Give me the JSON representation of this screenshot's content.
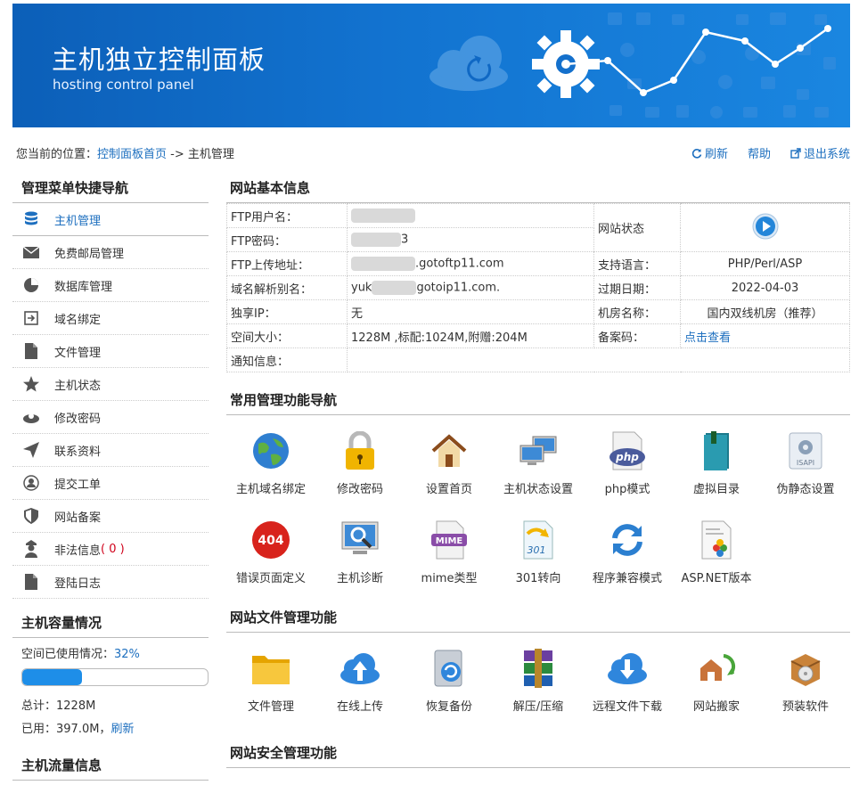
{
  "banner": {
    "title": "主机独立控制面板",
    "subtitle": "hosting control panel"
  },
  "breadcrumb": {
    "prefix": "您当前的位置：",
    "home": "控制面板首页",
    "sep": " -> ",
    "current": "主机管理"
  },
  "toplinks": {
    "refresh": "刷新",
    "help": "帮助",
    "logout": "退出系统"
  },
  "sidebar": {
    "title": "管理菜单快捷导航",
    "items": [
      {
        "label": "主机管理",
        "icon": "database-icon"
      },
      {
        "label": "免费邮局管理",
        "icon": "mail-icon"
      },
      {
        "label": "数据库管理",
        "icon": "pie-icon"
      },
      {
        "label": "域名绑定",
        "icon": "login-arrow-icon"
      },
      {
        "label": "文件管理",
        "icon": "file-icon"
      },
      {
        "label": "主机状态",
        "icon": "star-icon"
      },
      {
        "label": "修改密码",
        "icon": "key-icon"
      },
      {
        "label": "联系资料",
        "icon": "send-icon"
      },
      {
        "label": "提交工单",
        "icon": "user-icon"
      },
      {
        "label": "网站备案",
        "icon": "shield-icon"
      },
      {
        "label": "非法信息",
        "icon": "police-icon",
        "count": "( 0 )"
      },
      {
        "label": "登陆日志",
        "icon": "file-icon"
      }
    ]
  },
  "capacity": {
    "title": "主机容量情况",
    "used_label": "空间已使用情况：",
    "used_pct": "32%",
    "used_fraction": 0.32,
    "total": "总计：1228M",
    "used": "已用：397.0M，",
    "refresh": "刷新"
  },
  "traffic": {
    "title": "主机流量信息"
  },
  "info": {
    "title": "网站基本信息",
    "ftp_user": "FTP用户名：",
    "ftp_pass": "FTP密码：",
    "ftp_pass_val": "3",
    "ftp_addr": "FTP上传地址：",
    "ftp_addr_val": ".gotoftp11.com",
    "domain_alias": "域名解析别名：",
    "domain_alias_val_a": "yuk",
    "domain_alias_val_b": "gotoip11.com.",
    "ip": "独享IP：",
    "ip_val": "无",
    "space": "空间大小：",
    "space_val": "1228M ,标配:1024M,附赠:204M",
    "notice": "通知信息：",
    "status": "网站状态",
    "lang": "支持语言：",
    "lang_val": "PHP/Perl/ASP",
    "expire": "过期日期：",
    "expire_val": "2022-04-03",
    "room": "机房名称：",
    "room_val": "国内双线机房（推荐）",
    "beian": "备案码：",
    "beian_val": "点击查看"
  },
  "nav": {
    "title": "常用管理功能导航",
    "tools": [
      {
        "label": "主机域名绑定",
        "icon": "globe-icon"
      },
      {
        "label": "修改密码",
        "icon": "padlock-icon"
      },
      {
        "label": "设置首页",
        "icon": "house-icon"
      },
      {
        "label": "主机状态设置",
        "icon": "computers-icon"
      },
      {
        "label": "php模式",
        "icon": "php-icon"
      },
      {
        "label": "虚拟目录",
        "icon": "book-icon"
      },
      {
        "label": "伪静态设置",
        "icon": "isapi-icon"
      },
      {
        "label": "错误页面定义",
        "icon": "error-404-icon"
      },
      {
        "label": "主机诊断",
        "icon": "monitor-search-icon"
      },
      {
        "label": "mime类型",
        "icon": "mime-icon"
      },
      {
        "label": "301转向",
        "icon": "redirect-301-icon"
      },
      {
        "label": "程序兼容模式",
        "icon": "sync-icon"
      },
      {
        "label": "ASP.NET版本",
        "icon": "aspnet-icon"
      }
    ]
  },
  "files": {
    "title": "网站文件管理功能",
    "tools": [
      {
        "label": "文件管理",
        "icon": "folder-icon"
      },
      {
        "label": "在线上传",
        "icon": "cloud-upload-icon"
      },
      {
        "label": "恢复备份",
        "icon": "restore-icon"
      },
      {
        "label": "解压/压缩",
        "icon": "archive-icon"
      },
      {
        "label": "远程文件下载",
        "icon": "cloud-download-icon"
      },
      {
        "label": "网站搬家",
        "icon": "move-house-icon"
      },
      {
        "label": "预装软件",
        "icon": "software-box-icon"
      }
    ]
  },
  "security": {
    "title": "网站安全管理功能"
  }
}
